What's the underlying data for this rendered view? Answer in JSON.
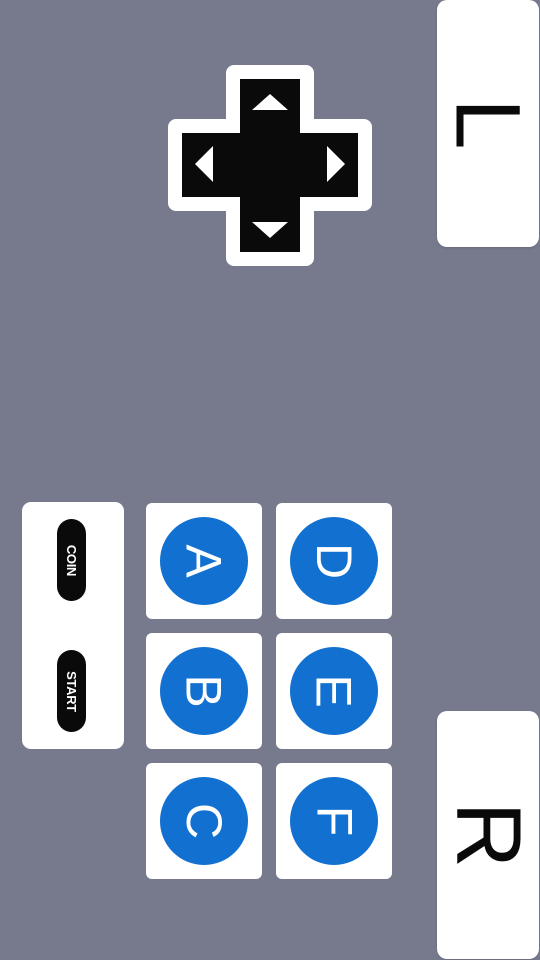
{
  "colors": {
    "background": "#767a8c",
    "panel": "#ffffff",
    "dpad": "#0a0a0a",
    "action_button": "#1170d0",
    "action_label": "#ffffff"
  },
  "shoulder_buttons": {
    "left_label": "L",
    "right_label": "R"
  },
  "dpad": {
    "icons": [
      "up-arrow",
      "down-arrow",
      "left-arrow",
      "right-arrow"
    ]
  },
  "system_buttons": {
    "coin_label": "COIN",
    "start_label": "START"
  },
  "action_buttons": {
    "a": "A",
    "b": "B",
    "c": "C",
    "d": "D",
    "e": "E",
    "f": "F"
  }
}
